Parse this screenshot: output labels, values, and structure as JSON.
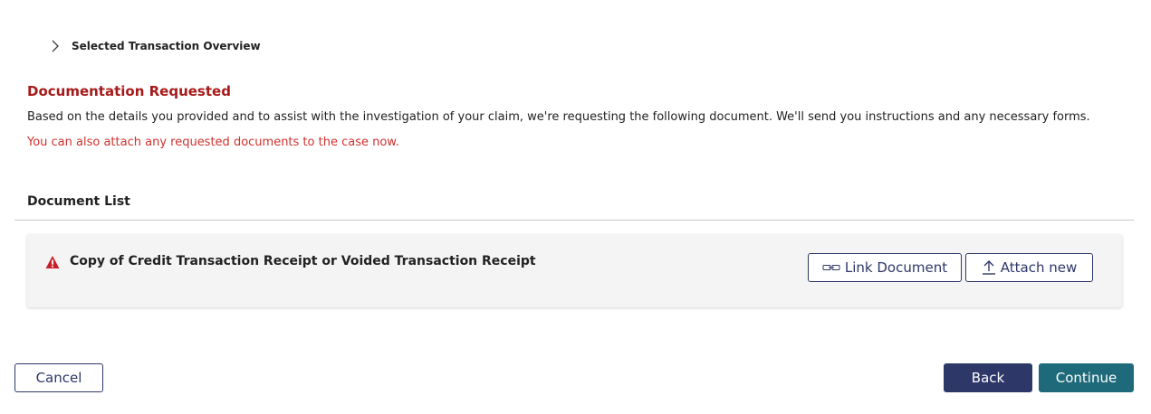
{
  "overview": {
    "label": "Selected Transaction Overview",
    "icon": "chevron-right-icon"
  },
  "documentation": {
    "title": "Documentation Requested",
    "description": "Based on the details you provided and to assist with the investigation of your claim, we're requesting the following document. We'll send you instructions and any necessary forms.",
    "attach_note": "You can also attach any requested documents to the case now."
  },
  "document_list": {
    "title": "Document List",
    "items": [
      {
        "name": "Copy of Credit Transaction Receipt or Voided Transaction Receipt",
        "status_icon": "warning-icon",
        "link_label": "Link Document",
        "attach_label": "Attach new"
      }
    ]
  },
  "footer": {
    "cancel_label": "Cancel",
    "back_label": "Back",
    "continue_label": "Continue"
  },
  "colors": {
    "title_red": "#a71a1a",
    "note_red": "#d0312d",
    "navy": "#2d3768",
    "teal": "#1e6a7a",
    "card_bg": "#f4f4f4"
  }
}
